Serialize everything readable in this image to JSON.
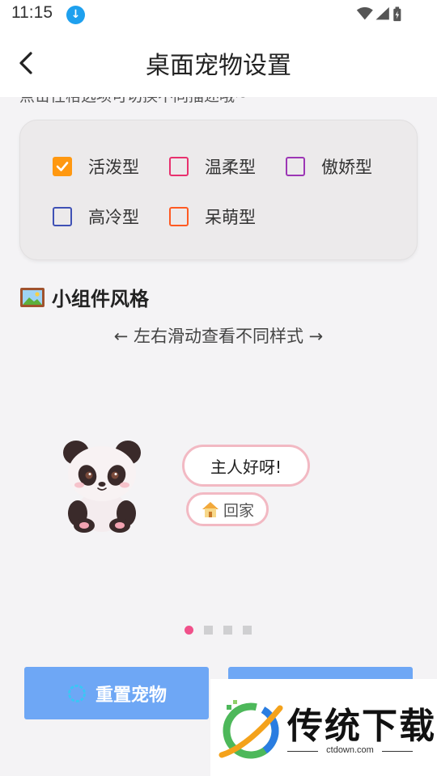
{
  "status_bar": {
    "time": "11:15",
    "download_icon": "download-icon",
    "icons": [
      "wifi-icon",
      "signal-icon",
      "battery-charging-icon"
    ]
  },
  "header": {
    "title": "桌面宠物设置",
    "back_icon": "chevron-left-icon"
  },
  "personality": {
    "hint_partial": "点击性格选项可切换不同描述哦~",
    "options": [
      {
        "label": "活泼型",
        "checked": true,
        "color": "#ff9810"
      },
      {
        "label": "温柔型",
        "checked": false,
        "color": "#e8316e"
      },
      {
        "label": "傲娇型",
        "checked": false,
        "color": "#9c36b5"
      },
      {
        "label": "高冷型",
        "checked": false,
        "color": "#3f51b5"
      },
      {
        "label": "呆萌型",
        "checked": false,
        "color": "#ff5a22"
      }
    ]
  },
  "widget_style": {
    "icon": "framed-picture-icon",
    "title": "小组件风格",
    "swipe_hint": "← 左右滑动查看不同样式 →",
    "preview": {
      "pet": "panda-icon",
      "bubble_text": "主人好呀!",
      "home_icon": "house-icon",
      "home_label": "回家"
    },
    "pages": 4,
    "current_page": 1
  },
  "actions": {
    "reset_icon": "refresh-icon",
    "reset_label": "重置宠物"
  },
  "watermark": {
    "text": "传统下载",
    "url": "ctdown.com"
  },
  "colors": {
    "accent_blue": "#6ea7f5",
    "bubble_border": "#f2b9c3",
    "active_dot": "#f0508a"
  }
}
